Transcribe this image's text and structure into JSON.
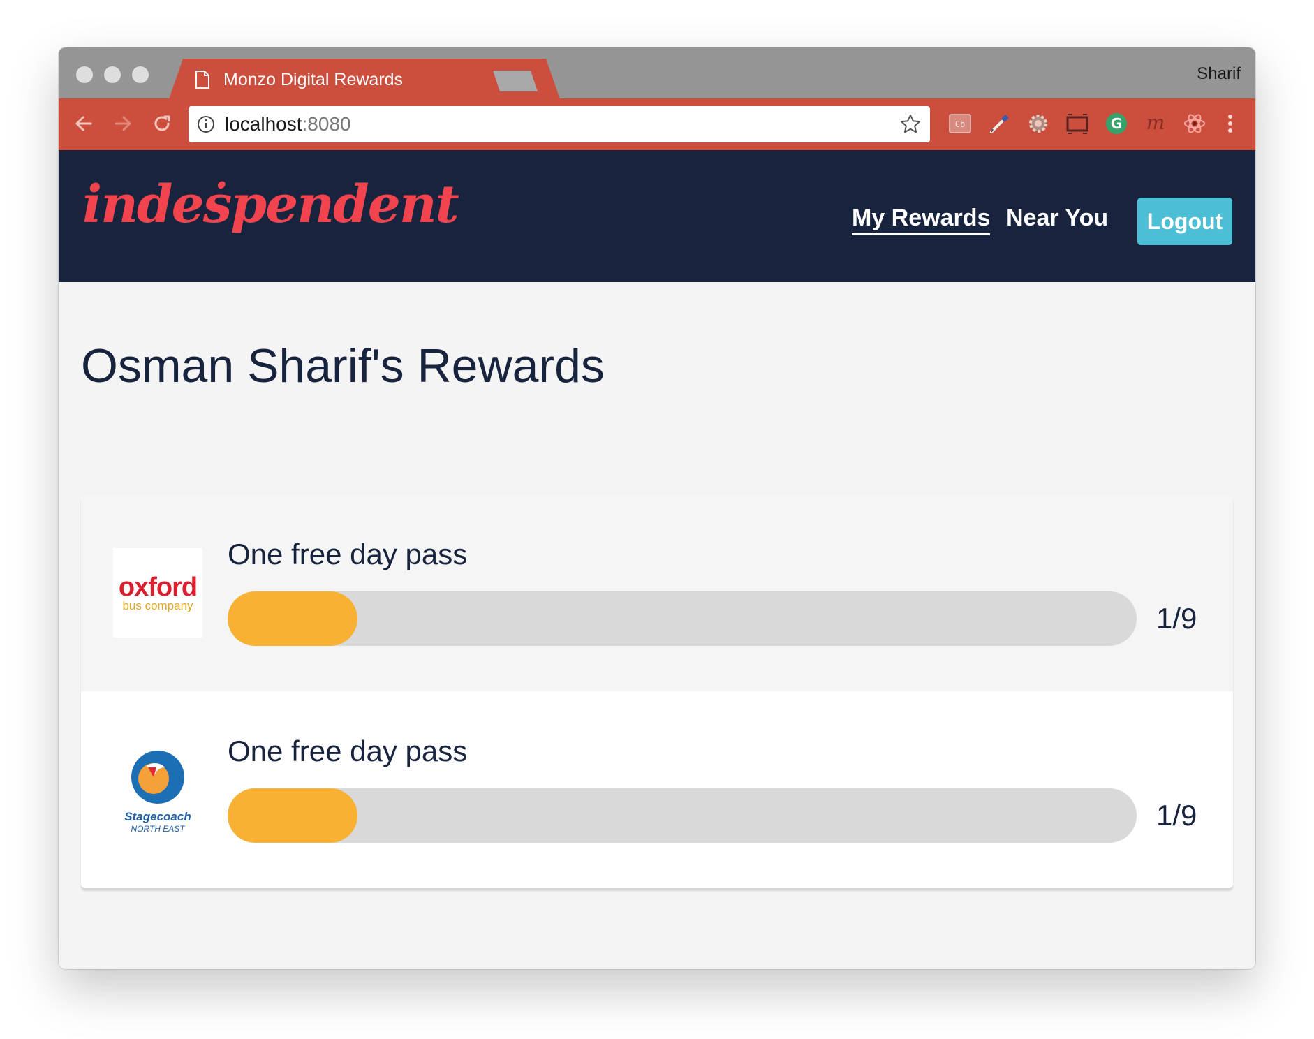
{
  "browser": {
    "tab_title": "Monzo Digital Rewards",
    "tab_icon": "page-icon",
    "close_glyph": "×",
    "profile_name": "Sharif",
    "url_host": "localhost",
    "url_port": ":8080",
    "tab_color": "#cc4f3e",
    "extensions": [
      "cb-extension-icon",
      "eyedropper-icon",
      "settings-cog-icon",
      "window-resize-icon",
      "grammarly-icon",
      "m-extension-icon",
      "react-devtools-icon"
    ]
  },
  "header": {
    "logo_text": "indeṡpendent",
    "nav": [
      {
        "label": "My Rewards",
        "active": true
      },
      {
        "label": "Near You",
        "active": false
      }
    ],
    "logout_label": "Logout",
    "background_color": "#18233d",
    "logo_color": "#f2444f",
    "logout_color": "#4cbfd7"
  },
  "page": {
    "title": "Osman Sharif's Rewards"
  },
  "rewards": [
    {
      "brand_top": "oxford",
      "brand_bottom": "bus company",
      "title": "One free day pass",
      "count_text": "1/9",
      "progress": 0.1111
    },
    {
      "brand_top": "Stagecoach",
      "brand_bottom": "NORTH EAST",
      "title": "One free day pass",
      "count_text": "1/9",
      "progress": 0.1111
    }
  ],
  "colors": {
    "progress_fill": "#f8b133",
    "progress_track": "#d9d9d9",
    "heading": "#18233d"
  }
}
